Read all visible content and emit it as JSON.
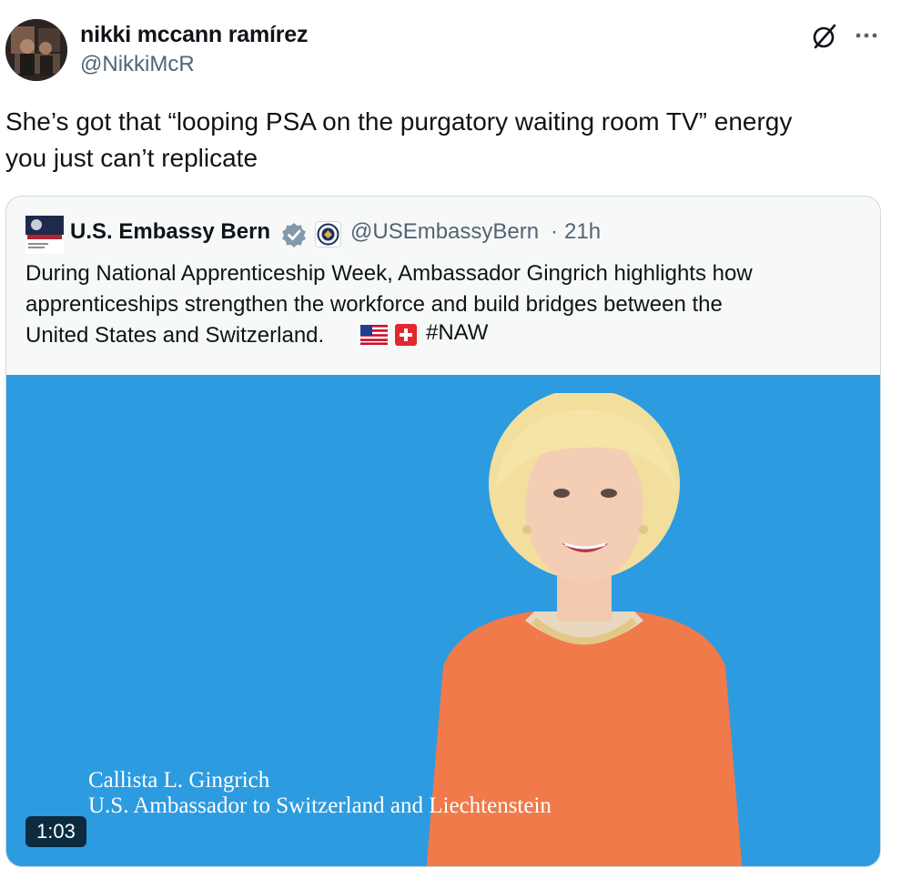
{
  "author": {
    "display_name": "nikki mccann ramírez",
    "handle": "@NikkiMcR"
  },
  "icons": {
    "grok": "grok-slash-icon",
    "more": "more-horizontal-icon"
  },
  "tweet": {
    "text": "She’s got that “looping PSA on the purgatory waiting room TV” energy\nyou just can’t replicate"
  },
  "quote": {
    "display_name": "U.S. Embassy Bern",
    "handle": "@USEmbassyBern",
    "separator": "·",
    "time": "21h",
    "verified_color": "#829aab",
    "text": "During National Apprenticeship Week, Ambassador Gingrich highlights how\napprenticeships strengthen the workforce and build bridges between the\nUnited States and Switzerland.",
    "hashtag": "#NAW",
    "media": {
      "background_color": "#2d9be0",
      "caption_name": "Callista L. Gingrich",
      "caption_title": "U.S. Ambassador to Switzerland and Liechtenstein",
      "duration": "1:03"
    }
  }
}
